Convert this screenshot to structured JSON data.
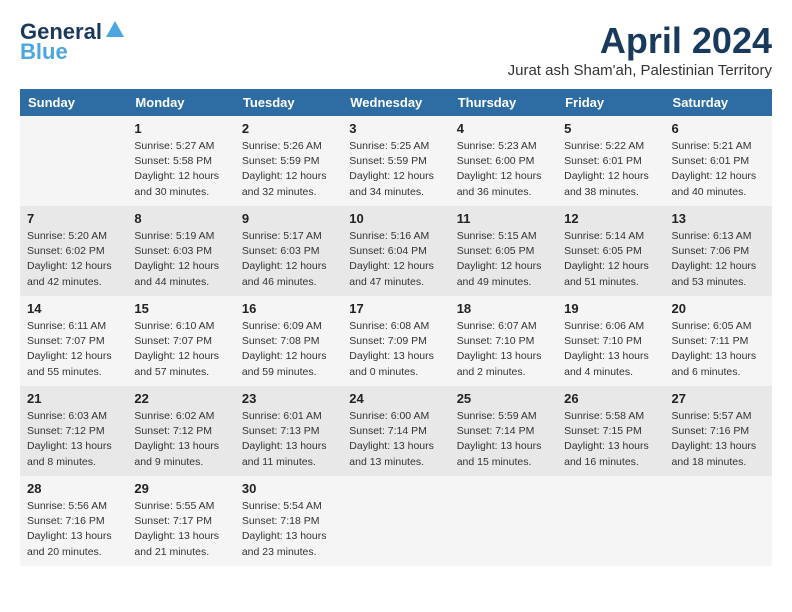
{
  "logo": {
    "line1": "General",
    "line2": "Blue"
  },
  "title": "April 2024",
  "subtitle": "Jurat ash Sham'ah, Palestinian Territory",
  "days_of_week": [
    "Sunday",
    "Monday",
    "Tuesday",
    "Wednesday",
    "Thursday",
    "Friday",
    "Saturday"
  ],
  "weeks": [
    [
      {
        "day": "",
        "info": ""
      },
      {
        "day": "1",
        "info": "Sunrise: 5:27 AM\nSunset: 5:58 PM\nDaylight: 12 hours\nand 30 minutes."
      },
      {
        "day": "2",
        "info": "Sunrise: 5:26 AM\nSunset: 5:59 PM\nDaylight: 12 hours\nand 32 minutes."
      },
      {
        "day": "3",
        "info": "Sunrise: 5:25 AM\nSunset: 5:59 PM\nDaylight: 12 hours\nand 34 minutes."
      },
      {
        "day": "4",
        "info": "Sunrise: 5:23 AM\nSunset: 6:00 PM\nDaylight: 12 hours\nand 36 minutes."
      },
      {
        "day": "5",
        "info": "Sunrise: 5:22 AM\nSunset: 6:01 PM\nDaylight: 12 hours\nand 38 minutes."
      },
      {
        "day": "6",
        "info": "Sunrise: 5:21 AM\nSunset: 6:01 PM\nDaylight: 12 hours\nand 40 minutes."
      }
    ],
    [
      {
        "day": "7",
        "info": "Sunrise: 5:20 AM\nSunset: 6:02 PM\nDaylight: 12 hours\nand 42 minutes."
      },
      {
        "day": "8",
        "info": "Sunrise: 5:19 AM\nSunset: 6:03 PM\nDaylight: 12 hours\nand 44 minutes."
      },
      {
        "day": "9",
        "info": "Sunrise: 5:17 AM\nSunset: 6:03 PM\nDaylight: 12 hours\nand 46 minutes."
      },
      {
        "day": "10",
        "info": "Sunrise: 5:16 AM\nSunset: 6:04 PM\nDaylight: 12 hours\nand 47 minutes."
      },
      {
        "day": "11",
        "info": "Sunrise: 5:15 AM\nSunset: 6:05 PM\nDaylight: 12 hours\nand 49 minutes."
      },
      {
        "day": "12",
        "info": "Sunrise: 5:14 AM\nSunset: 6:05 PM\nDaylight: 12 hours\nand 51 minutes."
      },
      {
        "day": "13",
        "info": "Sunrise: 6:13 AM\nSunset: 7:06 PM\nDaylight: 12 hours\nand 53 minutes."
      }
    ],
    [
      {
        "day": "14",
        "info": "Sunrise: 6:11 AM\nSunset: 7:07 PM\nDaylight: 12 hours\nand 55 minutes."
      },
      {
        "day": "15",
        "info": "Sunrise: 6:10 AM\nSunset: 7:07 PM\nDaylight: 12 hours\nand 57 minutes."
      },
      {
        "day": "16",
        "info": "Sunrise: 6:09 AM\nSunset: 7:08 PM\nDaylight: 12 hours\nand 59 minutes."
      },
      {
        "day": "17",
        "info": "Sunrise: 6:08 AM\nSunset: 7:09 PM\nDaylight: 13 hours\nand 0 minutes."
      },
      {
        "day": "18",
        "info": "Sunrise: 6:07 AM\nSunset: 7:10 PM\nDaylight: 13 hours\nand 2 minutes."
      },
      {
        "day": "19",
        "info": "Sunrise: 6:06 AM\nSunset: 7:10 PM\nDaylight: 13 hours\nand 4 minutes."
      },
      {
        "day": "20",
        "info": "Sunrise: 6:05 AM\nSunset: 7:11 PM\nDaylight: 13 hours\nand 6 minutes."
      }
    ],
    [
      {
        "day": "21",
        "info": "Sunrise: 6:03 AM\nSunset: 7:12 PM\nDaylight: 13 hours\nand 8 minutes."
      },
      {
        "day": "22",
        "info": "Sunrise: 6:02 AM\nSunset: 7:12 PM\nDaylight: 13 hours\nand 9 minutes."
      },
      {
        "day": "23",
        "info": "Sunrise: 6:01 AM\nSunset: 7:13 PM\nDaylight: 13 hours\nand 11 minutes."
      },
      {
        "day": "24",
        "info": "Sunrise: 6:00 AM\nSunset: 7:14 PM\nDaylight: 13 hours\nand 13 minutes."
      },
      {
        "day": "25",
        "info": "Sunrise: 5:59 AM\nSunset: 7:14 PM\nDaylight: 13 hours\nand 15 minutes."
      },
      {
        "day": "26",
        "info": "Sunrise: 5:58 AM\nSunset: 7:15 PM\nDaylight: 13 hours\nand 16 minutes."
      },
      {
        "day": "27",
        "info": "Sunrise: 5:57 AM\nSunset: 7:16 PM\nDaylight: 13 hours\nand 18 minutes."
      }
    ],
    [
      {
        "day": "28",
        "info": "Sunrise: 5:56 AM\nSunset: 7:16 PM\nDaylight: 13 hours\nand 20 minutes."
      },
      {
        "day": "29",
        "info": "Sunrise: 5:55 AM\nSunset: 7:17 PM\nDaylight: 13 hours\nand 21 minutes."
      },
      {
        "day": "30",
        "info": "Sunrise: 5:54 AM\nSunset: 7:18 PM\nDaylight: 13 hours\nand 23 minutes."
      },
      {
        "day": "",
        "info": ""
      },
      {
        "day": "",
        "info": ""
      },
      {
        "day": "",
        "info": ""
      },
      {
        "day": "",
        "info": ""
      }
    ]
  ]
}
